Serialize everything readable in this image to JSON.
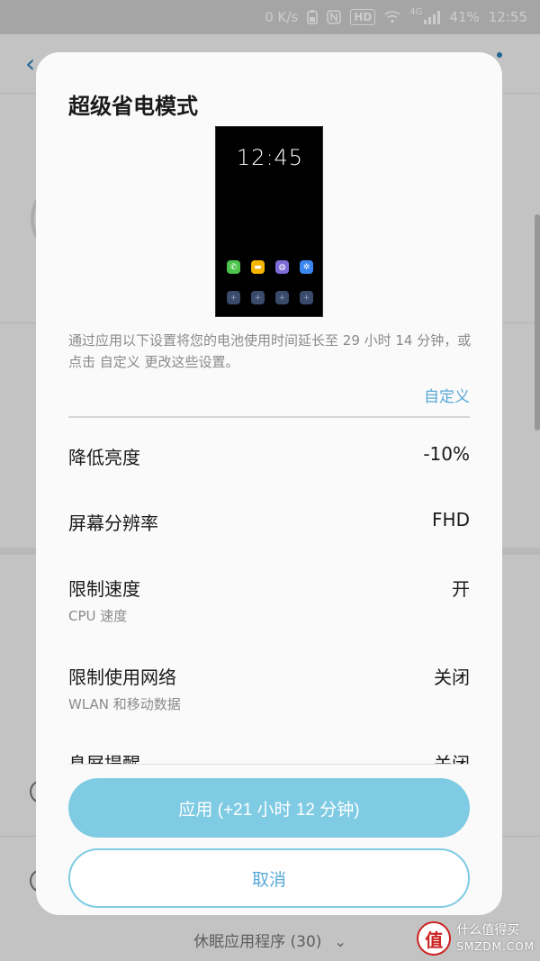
{
  "status_bar": {
    "speed": "0 K/s",
    "hd_label": "HD",
    "network_label": "4G",
    "battery": "41%",
    "time": "12:55"
  },
  "background": {
    "footer_label": "休眠应用程序 (30)"
  },
  "dialog": {
    "title": "超级省电模式",
    "preview_time": "12:45",
    "description": "通过应用以下设置将您的电池使用时间延长至 29 小时 14 分钟，或点击 自定义 更改这些设置。",
    "customize_label": "自定义",
    "settings": [
      {
        "label": "降低亮度",
        "sub": "",
        "value": "-10%"
      },
      {
        "label": "屏幕分辨率",
        "sub": "",
        "value": "FHD"
      },
      {
        "label": "限制速度",
        "sub": "CPU 速度",
        "value": "开"
      },
      {
        "label": "限制使用网络",
        "sub": "WLAN 和移动数据",
        "value": "关闭"
      },
      {
        "label": "息屏提醒",
        "sub": "",
        "value": "关闭"
      }
    ],
    "apply_label": "应用 (+21 小时 12 分钟)",
    "cancel_label": "取消"
  },
  "watermark": {
    "badge": "值",
    "line1": "什么值得买",
    "line2": "SMZDM.COM"
  },
  "colors": {
    "accent": "#5aa9d8",
    "apply_button": "#7ecbe3"
  }
}
